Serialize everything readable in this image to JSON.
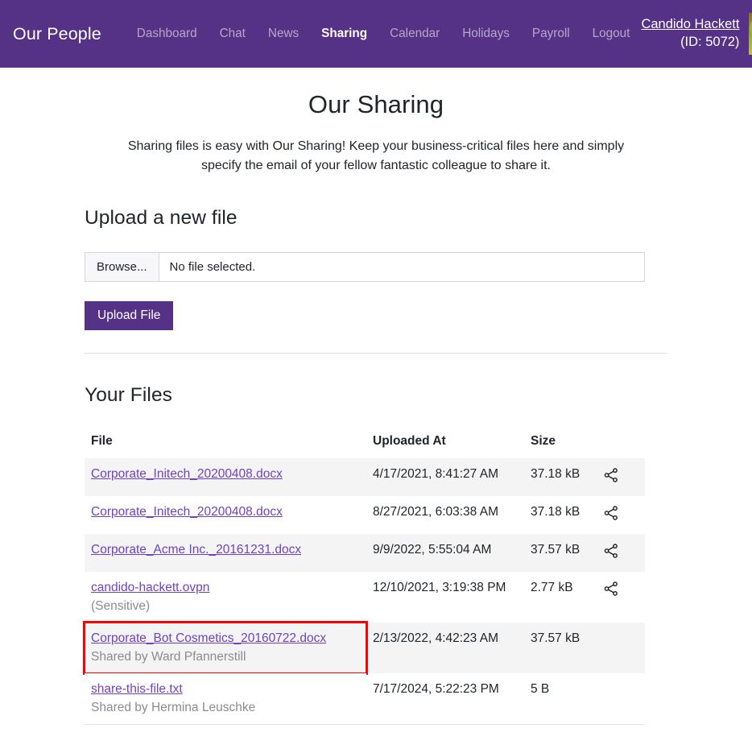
{
  "navbar": {
    "brand": "Our People",
    "links": [
      {
        "label": "Dashboard",
        "active": false
      },
      {
        "label": "Chat",
        "active": false
      },
      {
        "label": "News",
        "active": false
      },
      {
        "label": "Sharing",
        "active": true
      },
      {
        "label": "Calendar",
        "active": false
      },
      {
        "label": "Holidays",
        "active": false
      },
      {
        "label": "Payroll",
        "active": false
      },
      {
        "label": "Logout",
        "active": false
      }
    ],
    "user": {
      "name": "Candido Hackett",
      "id_text": "(ID: 5072)",
      "avatar": "user-avatar-photo"
    },
    "background_color": "#553285",
    "active_link_color": "#ffffff",
    "inactive_link_color": "rgba(255,255,255,0.56)"
  },
  "page": {
    "title": "Our Sharing",
    "lede": "Sharing files is easy with Our Sharing! Keep your business-critical files here and simply specify the email of your fellow fantastic colleague to share it."
  },
  "upload": {
    "heading": "Upload a new file",
    "browse_label": "Browse...",
    "file_status": "No file selected.",
    "submit_label": "Upload File",
    "button_color": "#553285"
  },
  "files_section": {
    "heading": "Your Files",
    "columns": [
      "File",
      "Uploaded At",
      "Size",
      ""
    ],
    "share_icon": "share-nodes-icon",
    "highlight_color": "#ff0000",
    "link_color": "#6f42c1",
    "rows": [
      {
        "name": "Corporate_Initech_20200408.docx",
        "sub": "",
        "uploaded_at": "4/17/2021, 8:41:27 AM",
        "size": "37.18 kB",
        "shareable": true,
        "highlighted": false
      },
      {
        "name": "Corporate_Initech_20200408.docx",
        "sub": "",
        "uploaded_at": "8/27/2021, 6:03:38 AM",
        "size": "37.18 kB",
        "shareable": true,
        "highlighted": false
      },
      {
        "name": "Corporate_Acme Inc._20161231.docx",
        "sub": "",
        "uploaded_at": "9/9/2022, 5:55:04 AM",
        "size": "37.57 kB",
        "shareable": true,
        "highlighted": false
      },
      {
        "name": "candido-hackett.ovpn",
        "sub": "(Sensitive)",
        "uploaded_at": "12/10/2021, 3:19:38 PM",
        "size": "2.77 kB",
        "shareable": true,
        "highlighted": false
      },
      {
        "name": "Corporate_Bot Cosmetics_20160722.docx",
        "sub": "Shared by Ward Pfannerstill",
        "uploaded_at": "2/13/2022, 4:42:23 AM",
        "size": "37.57 kB",
        "shareable": false,
        "highlighted": true
      },
      {
        "name": "share-this-file.txt",
        "sub": "Shared by Hermina Leuschke",
        "uploaded_at": "7/17/2024, 5:22:23 PM",
        "size": "5 B",
        "shareable": false,
        "highlighted": false
      }
    ]
  }
}
